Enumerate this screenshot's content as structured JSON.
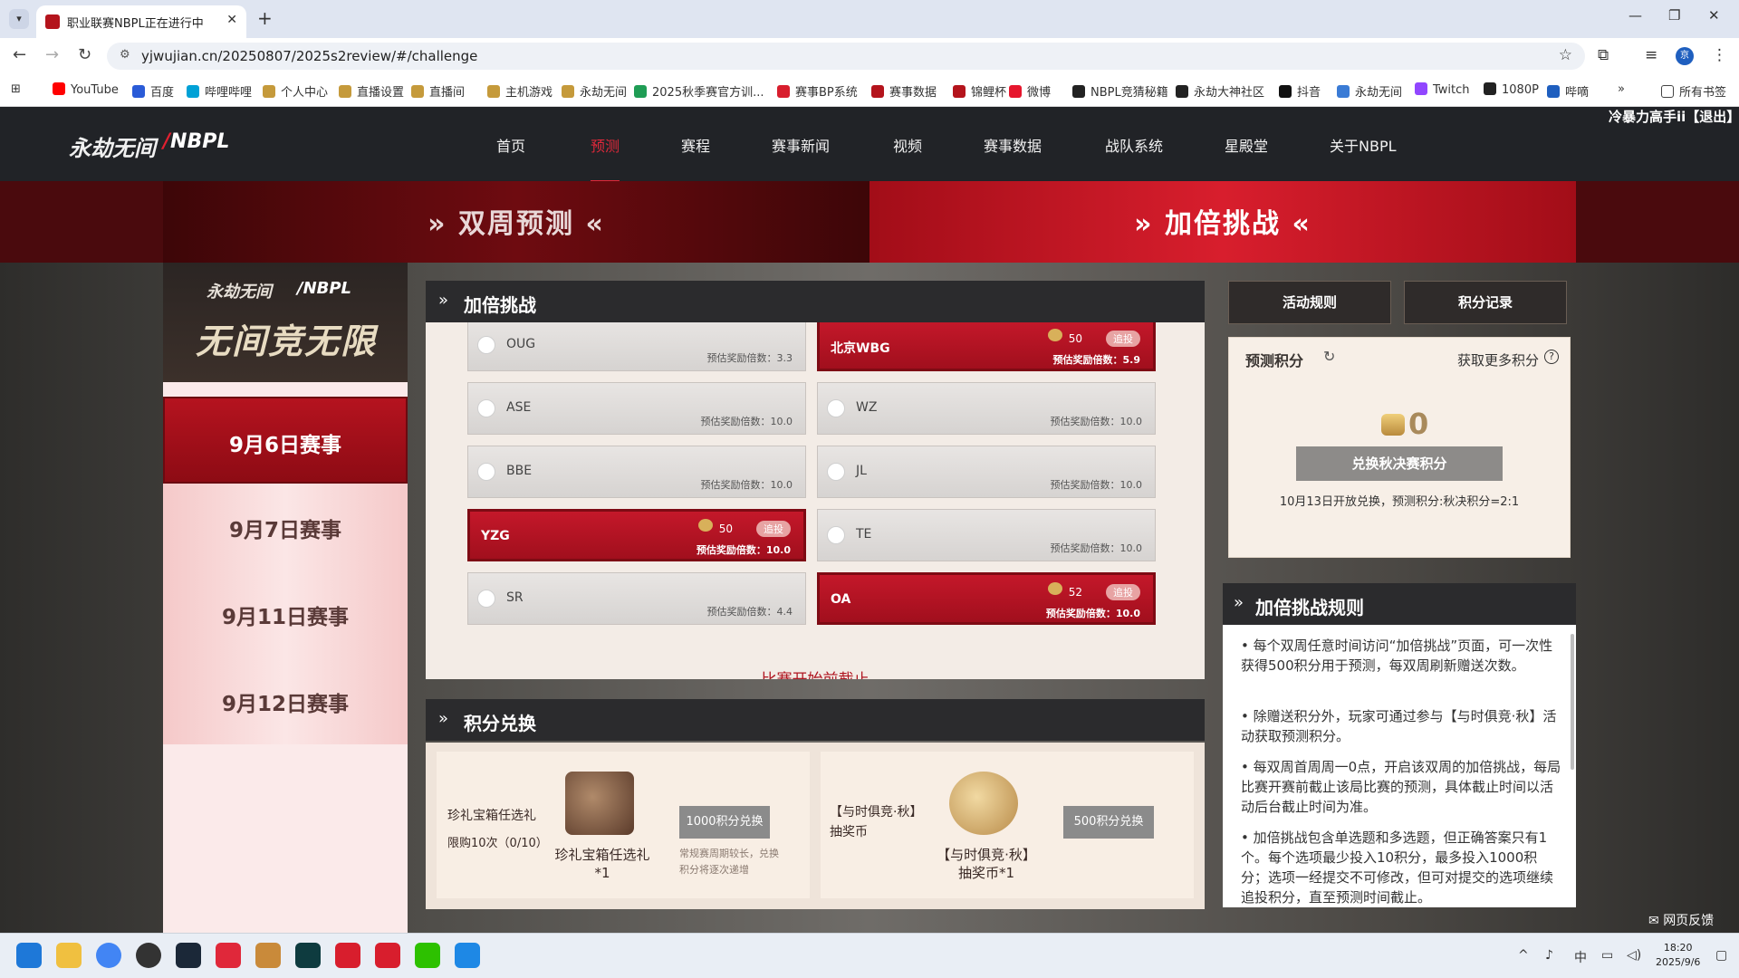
{
  "browser": {
    "tab_title": "职业联赛NBPL正在进行中",
    "url": "yjwujian.cn/20250807/2025s2review/#/challenge",
    "bookmarks": [
      "YouTube",
      "百度",
      "哔哩哔哩",
      "个人中心",
      "直播设置",
      "直播间",
      "主机游戏",
      "永劫无间",
      "2025秋季赛官方训...",
      "赛事BP系统",
      "赛事数据",
      "锦鲤杯",
      "微博",
      "NBPL竞猜秘籍",
      "永劫大神社区",
      "抖音",
      "永劫无间",
      "Twitch",
      "1080P",
      "哔嘀"
    ],
    "bookmarks_more": "»",
    "all_bookmarks": "所有书签",
    "profile_initial": "京"
  },
  "site": {
    "logo_game": "永劫无间",
    "logo_league": "NBPL",
    "nav": [
      "首页",
      "预测",
      "赛程",
      "赛事新闻",
      "视频",
      "赛事数据",
      "战队系统",
      "星殿堂",
      "关于NBPL"
    ],
    "nav_active_index": 1,
    "banner_left": "双周预测",
    "banner_right": "加倍挑战",
    "user": "冷暴力高手ii【退出】"
  },
  "left": {
    "logo_game": "永劫无间",
    "logo_league": "NBPL",
    "slogan": "无间竞无限",
    "days": [
      "9月6日赛事",
      "9月7日赛事",
      "9月11日赛事",
      "9月12日赛事"
    ],
    "active_day": 0
  },
  "challenge": {
    "title": "加倍挑战",
    "add_bet": "追投",
    "multiplier_label": "预估奖励倍数：",
    "options": [
      {
        "name": "OUG",
        "mult": "3.3",
        "selected": false
      },
      {
        "name": "北京WBG",
        "mult": "5.9",
        "selected": true,
        "amount": "50"
      },
      {
        "name": "ASE",
        "mult": "10.0",
        "selected": false
      },
      {
        "name": "WZ",
        "mult": "10.0",
        "selected": false
      },
      {
        "name": "BBE",
        "mult": "10.0",
        "selected": false
      },
      {
        "name": "JL",
        "mult": "10.0",
        "selected": false
      },
      {
        "name": "YZG",
        "mult": "10.0",
        "selected": true,
        "amount": "50"
      },
      {
        "name": "TE",
        "mult": "10.0",
        "selected": false
      },
      {
        "name": "SR",
        "mult": "4.4",
        "selected": false
      },
      {
        "name": "OA",
        "mult": "10.0",
        "selected": true,
        "amount": "52"
      }
    ],
    "deadline_text": "比赛开始前截止"
  },
  "exchange": {
    "title": "积分兑换",
    "items": [
      {
        "name": "珍礼宝箱任选礼",
        "limit": "限购10次（0/10）",
        "caption": "珍礼宝箱任选礼*1",
        "button": "1000积分兑换",
        "note": "常规赛周期较长，兑换积分将逐次递增"
      },
      {
        "name": "【与时俱竞·秋】抽奖币",
        "limit": "",
        "caption": "【与时俱竞·秋】抽奖币*1",
        "button": "500积分兑换",
        "note": ""
      }
    ]
  },
  "right": {
    "rules_button": "活动规则",
    "records_button": "积分记录",
    "points_label": "预测积分",
    "more_points": "获取更多积分",
    "help": "?",
    "points_value": "0",
    "exchange_button": "兑换秋决赛积分",
    "exchange_desc": "10月13日开放兑换，预测积分:秋决积分=2:1",
    "rules_title": "加倍挑战规则",
    "rules": [
      "• 每个双周任意时间访问“加倍挑战”页面，可一次性获得500积分用于预测，每双周刷新赠送次数。",
      "• 除赠送积分外，玩家可通过参与【与时俱竞·秋】活动获取预测积分。",
      "• 每双周首周周一0点，开启该双周的加倍挑战，每局比赛开赛前截止该局比赛的预测，具体截止时间以活动后台截止时间为准。",
      "• 加倍挑战包含单选题和多选题，但正确答案只有1个。每个选项最少投入10积分，最多投入1000积分；选项一经提交不可修改，但可对提交的选项继续追投积分，直至预测时间截止。"
    ],
    "feedback": "网页反馈"
  },
  "taskbar": {
    "ime": "中",
    "time": "18:20",
    "date": "2025/9/6"
  },
  "colors": {
    "accent_red": "#c4182a",
    "nav_bg": "#212327",
    "active_nav": "#e0283a"
  }
}
